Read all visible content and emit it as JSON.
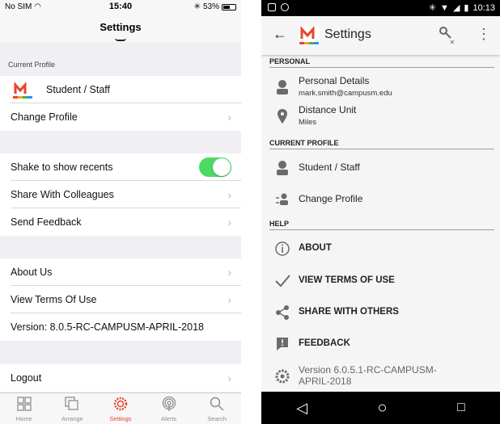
{
  "ios": {
    "status": {
      "carrier": "No SIM",
      "time": "15:40",
      "battery": "53%"
    },
    "nav_title": "Settings",
    "sections": {
      "current_profile_header": "Current Profile",
      "profile_name": "Student / Staff",
      "change_profile": "Change Profile",
      "shake": "Shake to show recents",
      "shake_on": true,
      "share": "Share With Colleagues",
      "feedback": "Send Feedback",
      "about": "About Us",
      "terms": "View Terms Of Use",
      "version": "Version: 8.0.5-RC-CAMPUSM-APRIL-2018",
      "logout": "Logout"
    },
    "tabs": [
      {
        "label": "Home",
        "icon": "grid-icon"
      },
      {
        "label": "Arrange",
        "icon": "stack-icon"
      },
      {
        "label": "Settings",
        "icon": "gear-icon",
        "active": true
      },
      {
        "label": "Alerts",
        "icon": "broadcast-icon"
      },
      {
        "label": "Search",
        "icon": "search-icon"
      }
    ],
    "accent": "#e8452c",
    "toggle_color": "#4cd964"
  },
  "android": {
    "status": {
      "time": "10:13"
    },
    "title": "Settings",
    "personal_header": "PERSONAL",
    "personal_details": "Personal Details",
    "email": "mark.smith@campusm.edu",
    "distance_unit": "Distance Unit",
    "distance_value": "Miles",
    "current_profile_header": "CURRENT PROFILE",
    "profile_name": "Student / Staff",
    "change_profile": "Change Profile",
    "help_header": "HELP",
    "about": "ABOUT",
    "terms": "VIEW TERMS OF USE",
    "share": "SHARE WITH OTHERS",
    "feedback": "FEEDBACK",
    "version": "Version 6.0.5.1-RC-CAMPUSM-APRIL-2018"
  }
}
